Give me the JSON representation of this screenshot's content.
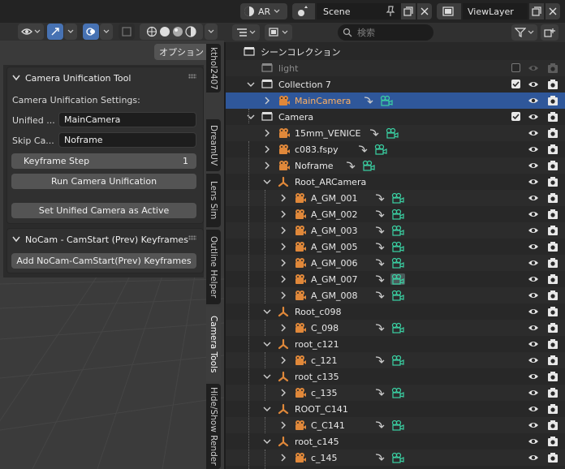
{
  "top_bar": {
    "scene_short": "AR",
    "scene_name": "Scene",
    "view_layer": "ViewLayer"
  },
  "viewport": {
    "options_label": "オプション"
  },
  "n_panel": {
    "tool_panel": {
      "title": "Camera Unification Tool",
      "settings_label": "Camera Unification Settings:",
      "unified_label": "Unified ...",
      "unified_value": "MainCamera",
      "skip_label": "Skip Ca...",
      "skip_value": "Noframe",
      "keyframe_label": "Keyframe Step",
      "keyframe_value": "1",
      "run_button": "Run Camera Unification",
      "set_active_button": "Set Unified Camera as Active"
    },
    "nocam_panel": {
      "title": "NoCam - CamStart (Prev) Keyframes",
      "add_button": "Add NoCam-CamStart(Prev) Keyframes"
    }
  },
  "side_tabs": [
    "Camera Tools",
    "Outline Helper",
    "Lens Sim",
    "DreamUV",
    "kthol2407",
    "Hide/Show Render"
  ],
  "outliner": {
    "search_placeholder": "検索",
    "rows": [
      {
        "label": "シーンコレクション"
      },
      {
        "label": "light"
      },
      {
        "label": "Collection 7"
      },
      {
        "label": "MainCamera"
      },
      {
        "label": "Camera"
      },
      {
        "label": "15mm_VENICE"
      },
      {
        "label": "c083.fspy"
      },
      {
        "label": "Noframe"
      },
      {
        "label": "Root_ARCamera"
      },
      {
        "label": "A_GM_001"
      },
      {
        "label": "A_GM_002"
      },
      {
        "label": "A_GM_003"
      },
      {
        "label": "A_GM_005"
      },
      {
        "label": "A_GM_006"
      },
      {
        "label": "A_GM_007"
      },
      {
        "label": "A_GM_008"
      },
      {
        "label": "Root_c098"
      },
      {
        "label": "C_098"
      },
      {
        "label": "root_c121"
      },
      {
        "label": "c_121"
      },
      {
        "label": "root_c135"
      },
      {
        "label": "c_135"
      },
      {
        "label": "ROOT_C141"
      },
      {
        "label": "C_C141"
      },
      {
        "label": "root_c145"
      },
      {
        "label": "c_145"
      }
    ]
  },
  "colors": {
    "selection": "#2f579a",
    "selected_text": "#ffb060",
    "camera_data": "#3ad1a3",
    "object_orange": "#e0883a",
    "accent_blue": "#4772b3"
  }
}
